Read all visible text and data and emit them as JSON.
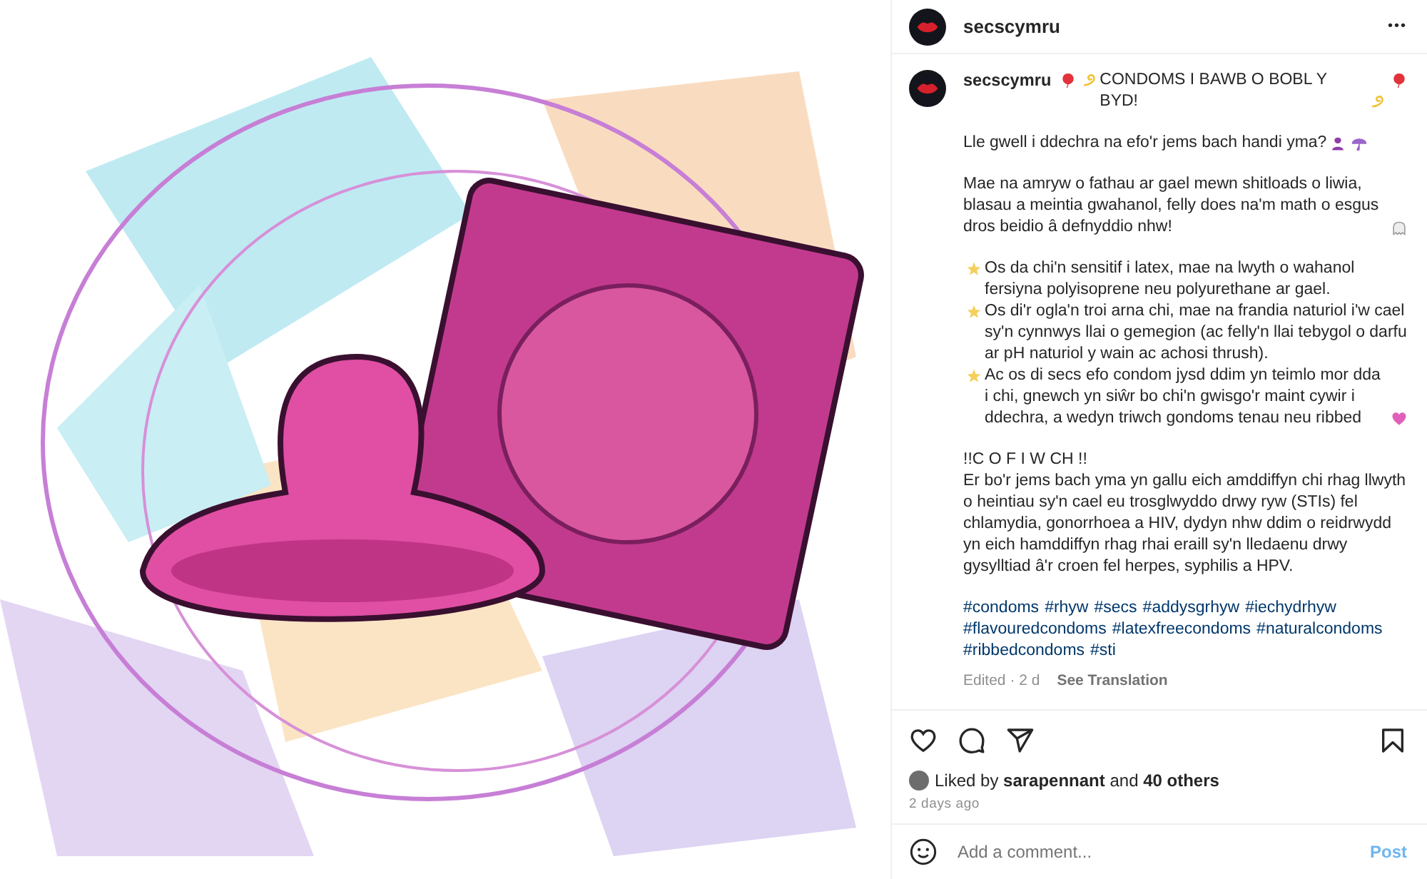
{
  "header": {
    "username": "secscymru",
    "more": "•••"
  },
  "caption": {
    "username": "secscymru",
    "paragraphs": [
      [
        [
          {
            "kind": "balloon"
          },
          {
            "kind": "dizzy"
          },
          {
            "kind": "text",
            "text": "CONDOMS I BAWB O BOBL Y BYD!"
          },
          {
            "kind": "dizzy"
          },
          {
            "kind": "balloon"
          }
        ]
      ],
      [
        [
          {
            "kind": "text",
            "text": "Lle gwell i ddechra na efo'r jems bach handi yma?"
          },
          {
            "kind": "figure"
          },
          {
            "kind": "umbrella"
          }
        ]
      ],
      [
        [
          {
            "kind": "text",
            "text": "Mae na amryw o fathau ar gael mewn shitloads o liwia, blasau a meintia gwahanol, felly does na'm math o esgus dros beidio â defnyddio nhw!"
          },
          {
            "kind": "ghost"
          }
        ]
      ],
      [
        [
          {
            "kind": "star"
          },
          {
            "kind": "text",
            "text": "Os da chi'n sensitif i latex, mae na lwyth o wahanol fersiyna polyisoprene neu polyurethane ar gael."
          }
        ],
        [
          {
            "kind": "star"
          },
          {
            "kind": "text",
            "text": "Os di'r ogla'n troi arna chi, mae na frandia naturiol i'w cael sy'n cynnwys llai o gemegion (ac felly'n llai tebygol o darfu ar pH naturiol y wain ac achosi thrush)."
          }
        ],
        [
          {
            "kind": "star"
          },
          {
            "kind": "text",
            "text": "Ac os di secs efo condom jysd ddim yn teimlo mor dda i chi, gnewch yn siŵr bo chi'n gwisgo'r maint cywir i ddechra, a wedyn triwch gondoms tenau neu ribbed"
          },
          {
            "kind": "heart"
          }
        ]
      ],
      [
        [
          {
            "kind": "text",
            "text": "!!C O F I W CH !!"
          }
        ],
        [
          {
            "kind": "text",
            "text": "Er bo'r jems bach yma yn gallu eich amddiffyn chi rhag llwyth o heintiau sy'n cael eu trosglwyddo drwy ryw (STIs) fel chlamydia, gonorrhoea a HIV, dydyn nhw ddim o reidrwydd yn eich hamddiffyn rhag rhai eraill sy'n lledaenu drwy gysylltiad â'r croen fel herpes, syphilis a HPV."
          }
        ]
      ]
    ],
    "hashtags": [
      "#condoms",
      "#rhyw",
      "#secs",
      "#addysgrhyw",
      "#iechydrhyw",
      "#flavouredcondoms",
      "#latexfreecondoms",
      "#naturalcondoms",
      "#ribbedcondoms",
      "#sti"
    ],
    "edited": "Edited · 2 d",
    "translate": "See Translation"
  },
  "likes": {
    "text": "Liked by **sarapennant** and **40 others**"
  },
  "time": "2 days ago",
  "comment": {
    "placeholder": "Add a comment...",
    "post": "Post",
    "post_disabled": true
  }
}
